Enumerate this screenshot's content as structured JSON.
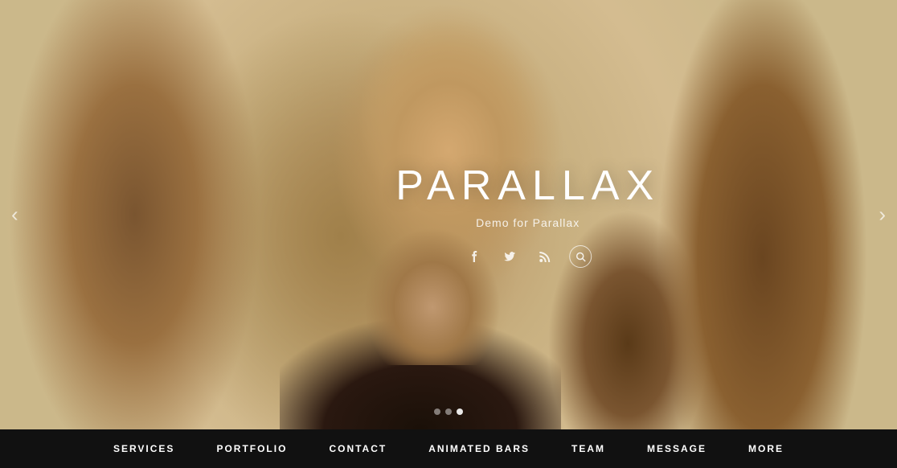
{
  "hero": {
    "title": "PARALLAX",
    "subtitle": "Demo for Parallax",
    "slides": [
      {
        "active": false
      },
      {
        "active": false
      },
      {
        "active": true
      }
    ]
  },
  "social": [
    {
      "name": "facebook",
      "icon": "f",
      "label": "Facebook"
    },
    {
      "name": "twitter",
      "icon": "t",
      "label": "Twitter"
    },
    {
      "name": "rss",
      "icon": "r",
      "label": "RSS"
    },
    {
      "name": "search",
      "icon": "🔍",
      "label": "Search"
    }
  ],
  "arrows": {
    "left": "‹",
    "right": "›"
  },
  "navbar": {
    "items": [
      {
        "label": "SERVICES"
      },
      {
        "label": "PORTFOLIO"
      },
      {
        "label": "CONTACT"
      },
      {
        "label": "ANIMATED BARS"
      },
      {
        "label": "TEAM"
      },
      {
        "label": "MESSAGE"
      },
      {
        "label": "MORE"
      }
    ]
  }
}
